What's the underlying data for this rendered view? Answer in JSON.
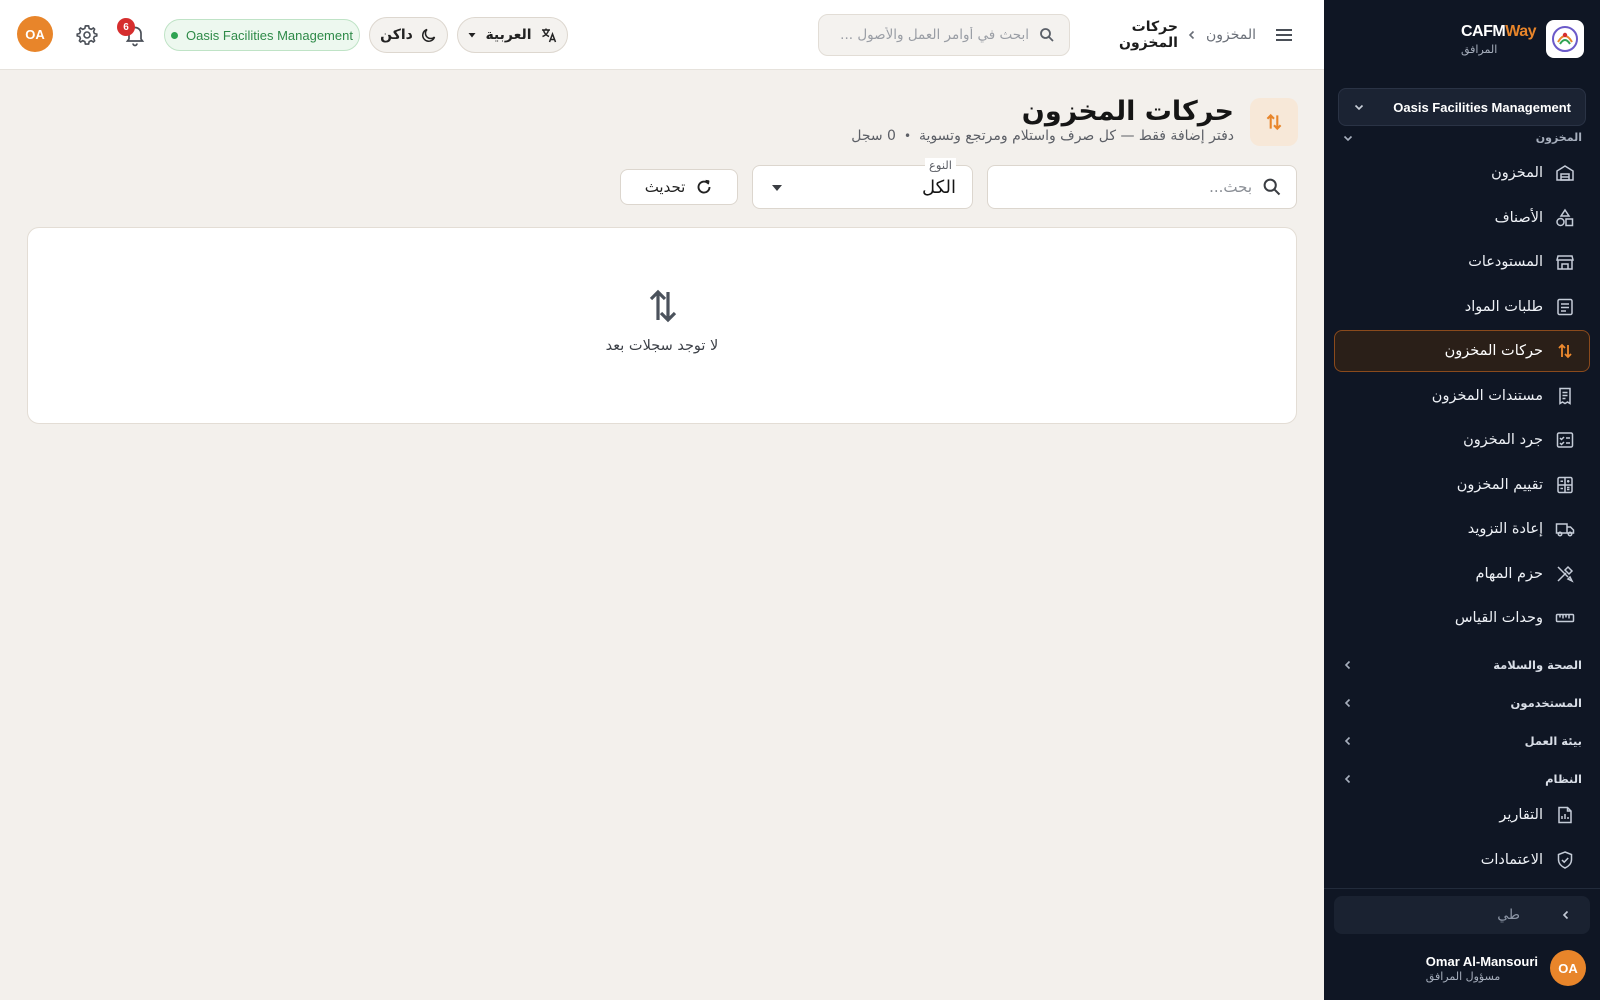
{
  "app": {
    "brand_name": "CAFM",
    "brand_name_accent": "Way",
    "brand_subtitle": "المرافق"
  },
  "sidebar": {
    "org_selector": "Oasis Facilities Management",
    "section_peek": "المخزون",
    "items": [
      {
        "label": "المخزون",
        "icon": "warehouse-icon"
      },
      {
        "label": "الأصناف",
        "icon": "shapes-icon"
      },
      {
        "label": "المستودعات",
        "icon": "store-icon"
      },
      {
        "label": "طلبات المواد",
        "icon": "list-icon"
      },
      {
        "label": "حركات المخزون",
        "icon": "swap-vertical-icon",
        "active": true
      },
      {
        "label": "مستندات المخزون",
        "icon": "receipt-icon"
      },
      {
        "label": "جرد المخزون",
        "icon": "checklist-icon"
      },
      {
        "label": "تقييم المخزون",
        "icon": "calculator-icon"
      },
      {
        "label": "إعادة التزويد",
        "icon": "truck-icon"
      },
      {
        "label": "حزم المهام",
        "icon": "tools-icon"
      },
      {
        "label": "وحدات القياس",
        "icon": "ruler-icon"
      }
    ],
    "sections": [
      {
        "label": "الصحة والسلامة"
      },
      {
        "label": "المستخدمون"
      },
      {
        "label": "بيئة العمل"
      },
      {
        "label": "النظام"
      }
    ],
    "bottom_items": [
      {
        "label": "التقارير",
        "icon": "report-icon"
      },
      {
        "label": "الاعتمادات",
        "icon": "shield-check-icon"
      }
    ],
    "collapse_label": "طي",
    "user": {
      "initials": "OA",
      "name": "Omar Al-Mansouri",
      "role": "مسؤول المرافق"
    }
  },
  "topbar": {
    "breadcrumb_parent": "المخزون",
    "breadcrumb_current": "حركات المخزون",
    "search_placeholder": "ابحث في أوامر العمل والأصول ...",
    "language_label": "العربية",
    "theme_label": "داكن",
    "org_badge": "Oasis Facilities Management",
    "notification_count": "6",
    "user_initials": "OA"
  },
  "page": {
    "title": "حركات المخزون",
    "subtitle": "دفتر إضافة فقط — كل صرف واستلام ومرتجع وتسوية",
    "record_count": "0 سجل",
    "search_placeholder": "بحث...",
    "type_filter_label": "النوع",
    "type_filter_value": "الكل",
    "refresh_label": "تحديث",
    "empty_message": "لا توجد سجلات بعد"
  },
  "colors": {
    "accent": "#e8852a",
    "sidebar_bg": "#0f1624",
    "page_bg": "#f3f0ec",
    "status_green": "#2fa352",
    "badge_red": "#d62e2e"
  }
}
